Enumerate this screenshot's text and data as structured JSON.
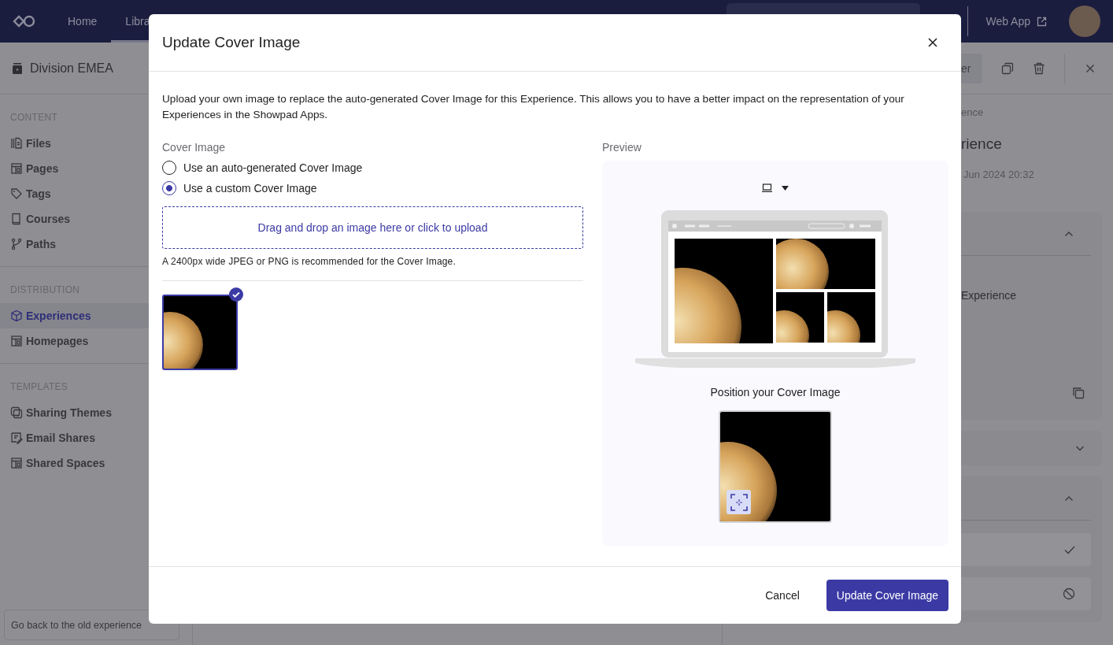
{
  "top_nav": {
    "links": [
      {
        "label": "Home",
        "selected": false
      },
      {
        "label": "Libra",
        "selected": true
      }
    ],
    "web_app_link": "Web App"
  },
  "sidebar": {
    "title": "Division EMEA",
    "sections": [
      {
        "heading": "CONTENT",
        "items": [
          {
            "label": "Files",
            "kind": "files",
            "selected": false
          },
          {
            "label": "Pages",
            "kind": "layout",
            "selected": false
          },
          {
            "label": "Tags",
            "kind": "tag",
            "selected": false
          },
          {
            "label": "Courses",
            "kind": "book",
            "selected": false
          },
          {
            "label": "Paths",
            "kind": "branch",
            "selected": false
          }
        ]
      },
      {
        "heading": "DISTRIBUTION",
        "items": [
          {
            "label": "Experiences",
            "kind": "cube",
            "selected": true
          },
          {
            "label": "Homepages",
            "kind": "layout",
            "selected": false
          }
        ]
      },
      {
        "heading": "TEMPLATES",
        "items": [
          {
            "label": "Sharing Themes",
            "kind": "theme",
            "selected": false
          },
          {
            "label": "Email Shares",
            "kind": "note",
            "selected": false
          },
          {
            "label": "Shared Spaces",
            "kind": "layout",
            "selected": false
          }
        ]
      }
    ],
    "footer_button": "Go back to the old experience"
  },
  "detail_panel": {
    "button_fragment": "er",
    "breadcrumb": "ence",
    "title": "rience",
    "date": "Jun 2024 20:32",
    "field_value": "Experience"
  },
  "dialog": {
    "title": "Update Cover Image",
    "description": "Upload your own image to replace the auto-generated Cover Image for this Experience. This allows you to have a better impact on the representation of your Experiences in the Showpad Apps.",
    "cover_image": {
      "label": "Cover Image",
      "options": [
        {
          "label": "Use an auto-generated Cover Image",
          "selected": false
        },
        {
          "label": "Use a custom Cover Image",
          "selected": true
        }
      ],
      "upload_zone": "Drag and drop an image here or click to upload",
      "hint": "A 2400px wide JPEG or PNG is recommended for the Cover Image.",
      "thumbnails": [
        {
          "selected": true
        }
      ]
    },
    "preview": {
      "label": "Preview",
      "position_label": "Position your Cover Image"
    },
    "buttons": [
      {
        "label": "Cancel",
        "kind": "secondary"
      },
      {
        "label": "Update Cover Image",
        "kind": "primary"
      }
    ]
  }
}
